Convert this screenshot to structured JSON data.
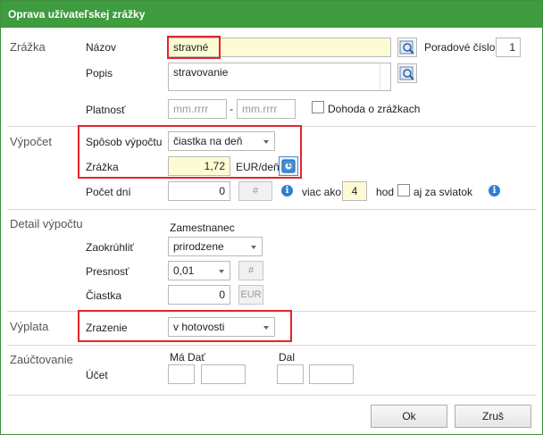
{
  "window": {
    "title": "Oprava užívateľskej zrážky"
  },
  "sections": {
    "zrazka": "Zrážka",
    "vypocet": "Výpočet",
    "detail": "Detail výpočtu",
    "vyplata": "Výplata",
    "zauctovanie": "Zaúčtovanie"
  },
  "zrazka": {
    "nazov_label": "Názov",
    "nazov_value": "stravné",
    "poradove_label": "Poradové číslo",
    "poradove_value": "1",
    "popis_label": "Popis",
    "popis_value": "stravovanie",
    "platnost_label": "Platnosť",
    "date_from_placeholder": "mm.rrrr",
    "date_sep": "-",
    "date_to_placeholder": "mm.rrrr",
    "dohoda_label": "Dohoda o zrážkach"
  },
  "vypocet": {
    "sposob_label": "Spôsob výpočtu",
    "sposob_value": "čiastka na deň",
    "zrazka_label": "Zrážka",
    "zrazka_value": "1,72",
    "zrazka_unit": "EUR/deň",
    "pocet_label": "Počet dní",
    "pocet_value": "0",
    "hash_label": "#",
    "viac_ako_label": "viac ako",
    "viac_ako_value": "4",
    "hod_label": "hod",
    "aj_za_sviatok_label": "aj za sviatok"
  },
  "detail": {
    "zamestnanec_label": "Zamestnanec",
    "zaokruhlit_label": "Zaokrúhliť",
    "zaokruhlit_value": "prirodzene",
    "presnost_label": "Presnosť",
    "presnost_value": "0,01",
    "hash_label": "#",
    "ciastka_label": "Čiastka",
    "ciastka_value": "0",
    "eur_label": "EUR"
  },
  "vyplata": {
    "zrazenie_label": "Zrazenie",
    "zrazenie_value": "v hotovosti"
  },
  "zauctovanie": {
    "ma_dat_label": "Má Dať",
    "dal_label": "Dal",
    "ucet_label": "Účet"
  },
  "buttons": {
    "ok": "Ok",
    "cancel": "Zruš"
  },
  "colors": {
    "title_bar": "#3e9b3e",
    "highlight_box": "#e3242b",
    "yellow_field": "#fdfbd3"
  }
}
